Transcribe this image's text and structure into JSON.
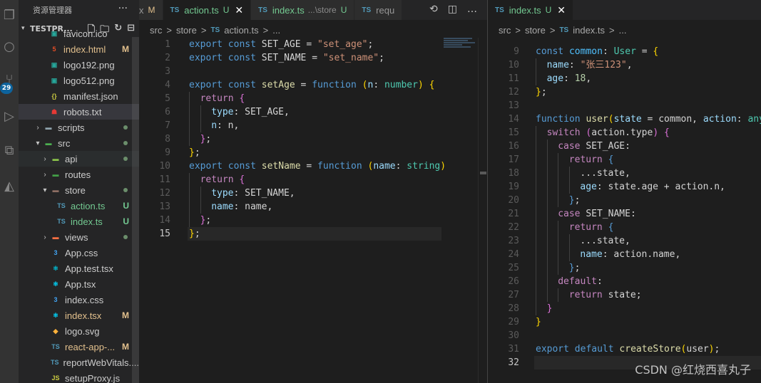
{
  "sidebar": {
    "title": "资源管理器",
    "more": "···",
    "project": "TESTPR...",
    "items": [
      {
        "label": "favicon.ico",
        "icon": "image-icon",
        "status": "",
        "indent": 42
      },
      {
        "label": "index.html",
        "icon": "html5-icon",
        "status": "M",
        "indent": 42
      },
      {
        "label": "logo192.png",
        "icon": "image-icon",
        "status": "",
        "indent": 42
      },
      {
        "label": "logo512.png",
        "icon": "image-icon",
        "status": "",
        "indent": 42
      },
      {
        "label": "manifest.json",
        "icon": "json-braces-icon",
        "status": "",
        "indent": 42
      },
      {
        "label": "robots.txt",
        "icon": "robot-icon",
        "status": "",
        "indent": 42
      },
      {
        "label": "scripts",
        "icon": "folder-icon",
        "status": "dot",
        "indent": 20,
        "folder": "closed"
      },
      {
        "label": "src",
        "icon": "folder-src-icon",
        "status": "dot",
        "indent": 20,
        "folder": "open"
      },
      {
        "label": "api",
        "icon": "folder-api-icon",
        "status": "dot",
        "indent": 30,
        "folder": "closed"
      },
      {
        "label": "routes",
        "icon": "folder-routes-icon",
        "status": "",
        "indent": 30,
        "folder": "closed"
      },
      {
        "label": "store",
        "icon": "folder-store-icon",
        "status": "dot",
        "indent": 30,
        "folder": "open"
      },
      {
        "label": "action.ts",
        "icon": "typescript-icon",
        "status": "U",
        "indent": 52
      },
      {
        "label": "index.ts",
        "icon": "typescript-icon",
        "status": "U",
        "indent": 52
      },
      {
        "label": "views",
        "icon": "folder-views-icon",
        "status": "dot",
        "indent": 30,
        "folder": "closed"
      },
      {
        "label": "App.css",
        "icon": "css-icon",
        "status": "",
        "indent": 44
      },
      {
        "label": "App.test.tsx",
        "icon": "react-test-icon",
        "status": "",
        "indent": 44
      },
      {
        "label": "App.tsx",
        "icon": "react-icon",
        "status": "",
        "indent": 44
      },
      {
        "label": "index.css",
        "icon": "css-icon",
        "status": "",
        "indent": 44
      },
      {
        "label": "index.tsx",
        "icon": "react-icon",
        "status": "M",
        "indent": 44
      },
      {
        "label": "logo.svg",
        "icon": "svg-icon",
        "status": "",
        "indent": 44
      },
      {
        "label": "react-app-...",
        "icon": "typescript-icon",
        "status": "M",
        "indent": 44
      },
      {
        "label": "reportWebVitals....",
        "icon": "typescript-icon",
        "status": "",
        "indent": 44
      },
      {
        "label": "setupProxy.js",
        "icon": "javascript-icon",
        "status": "",
        "indent": 44
      }
    ]
  },
  "left_editor": {
    "tabs": [
      {
        "ext": "",
        "label": "x",
        "status": "M",
        "active": false,
        "partial": true
      },
      {
        "ext": "TS",
        "label": "action.ts",
        "status": "U",
        "active": true,
        "close": "✕"
      },
      {
        "ext": "TS",
        "label": "index.ts",
        "desc": "...\\store",
        "status": "U",
        "active": false
      },
      {
        "ext": "TS",
        "label": "requ",
        "status": "",
        "active": false
      }
    ],
    "breadcrumb": [
      "src",
      ">",
      "store",
      ">",
      "TS",
      "action.ts",
      ">",
      "..."
    ],
    "current_line": 15,
    "lines": [
      {
        "n": 1,
        "indent": 0,
        "tokens": [
          [
            "k",
            "export"
          ],
          [
            "d",
            " "
          ],
          [
            "k",
            "const"
          ],
          [
            "d",
            " SET_AGE = "
          ],
          [
            "s",
            "\"set_age\""
          ],
          [
            "d",
            ";"
          ]
        ]
      },
      {
        "n": 2,
        "indent": 0,
        "tokens": [
          [
            "k",
            "export"
          ],
          [
            "d",
            " "
          ],
          [
            "k",
            "const"
          ],
          [
            "d",
            " SET_NAME = "
          ],
          [
            "s",
            "\"set_name\""
          ],
          [
            "d",
            ";"
          ]
        ]
      },
      {
        "n": 3,
        "indent": 0,
        "tokens": []
      },
      {
        "n": 4,
        "indent": 0,
        "tokens": [
          [
            "k",
            "export"
          ],
          [
            "d",
            " "
          ],
          [
            "k",
            "const"
          ],
          [
            "d",
            " "
          ],
          [
            "f",
            "setAge"
          ],
          [
            "d",
            " = "
          ],
          [
            "k",
            "function"
          ],
          [
            "d",
            " "
          ],
          [
            "p",
            "("
          ],
          [
            "v",
            "n"
          ],
          [
            "d",
            ": "
          ],
          [
            "t",
            "number"
          ],
          [
            "p",
            ")"
          ],
          [
            "d",
            " "
          ],
          [
            "p",
            "{"
          ]
        ]
      },
      {
        "n": 5,
        "indent": 1,
        "tokens": [
          [
            "kw",
            "return"
          ],
          [
            "d",
            " "
          ],
          [
            "p2",
            "{"
          ]
        ]
      },
      {
        "n": 6,
        "indent": 2,
        "tokens": [
          [
            "v",
            "type"
          ],
          [
            "d",
            ": SET_AGE,"
          ]
        ]
      },
      {
        "n": 7,
        "indent": 2,
        "tokens": [
          [
            "v",
            "n"
          ],
          [
            "d",
            ": n,"
          ]
        ]
      },
      {
        "n": 8,
        "indent": 1,
        "tokens": [
          [
            "p2",
            "}"
          ],
          [
            "d",
            ";"
          ]
        ]
      },
      {
        "n": 9,
        "indent": 0,
        "tokens": [
          [
            "p",
            "}"
          ],
          [
            "d",
            ";"
          ]
        ]
      },
      {
        "n": 10,
        "indent": 0,
        "tokens": [
          [
            "k",
            "export"
          ],
          [
            "d",
            " "
          ],
          [
            "k",
            "const"
          ],
          [
            "d",
            " "
          ],
          [
            "f",
            "setName"
          ],
          [
            "d",
            " = "
          ],
          [
            "k",
            "function"
          ],
          [
            "d",
            " "
          ],
          [
            "p",
            "("
          ],
          [
            "v",
            "name"
          ],
          [
            "d",
            ": "
          ],
          [
            "t",
            "string"
          ],
          [
            "p",
            ")"
          ]
        ]
      },
      {
        "n": 11,
        "indent": 1,
        "tokens": [
          [
            "kw",
            "return"
          ],
          [
            "d",
            " "
          ],
          [
            "p2",
            "{"
          ]
        ]
      },
      {
        "n": 12,
        "indent": 2,
        "tokens": [
          [
            "v",
            "type"
          ],
          [
            "d",
            ": SET_NAME,"
          ]
        ]
      },
      {
        "n": 13,
        "indent": 2,
        "tokens": [
          [
            "v",
            "name"
          ],
          [
            "d",
            ": name,"
          ]
        ]
      },
      {
        "n": 14,
        "indent": 1,
        "tokens": [
          [
            "p2",
            "}"
          ],
          [
            "d",
            ";"
          ]
        ]
      },
      {
        "n": 15,
        "indent": 0,
        "tokens": [
          [
            "p",
            "}"
          ],
          [
            "d",
            ";"
          ]
        ]
      }
    ]
  },
  "right_editor": {
    "tabs": [
      {
        "ext": "TS",
        "label": "index.ts",
        "status": "U",
        "active": true,
        "close": "✕"
      }
    ],
    "breadcrumb": [
      "src",
      ">",
      "store",
      ">",
      "TS",
      "index.ts",
      ">",
      "..."
    ],
    "current_line": 32,
    "lines": [
      {
        "n": 9,
        "indent": 0,
        "tokens": [
          [
            "k",
            "const"
          ],
          [
            "d",
            " "
          ],
          [
            "c",
            "common"
          ],
          [
            "d",
            ": "
          ],
          [
            "t",
            "User"
          ],
          [
            "d",
            " = "
          ],
          [
            "p",
            "{"
          ]
        ]
      },
      {
        "n": 10,
        "indent": 1,
        "tokens": [
          [
            "v",
            "name"
          ],
          [
            "d",
            ": "
          ],
          [
            "s",
            "\"张三123\""
          ],
          [
            "d",
            ","
          ]
        ]
      },
      {
        "n": 11,
        "indent": 1,
        "tokens": [
          [
            "v",
            "age"
          ],
          [
            "d",
            ": "
          ],
          [
            "n",
            "18"
          ],
          [
            "d",
            ","
          ]
        ]
      },
      {
        "n": 12,
        "indent": 0,
        "tokens": [
          [
            "p",
            "}"
          ],
          [
            "d",
            ";"
          ]
        ]
      },
      {
        "n": 13,
        "indent": 0,
        "tokens": []
      },
      {
        "n": 14,
        "indent": 0,
        "tokens": [
          [
            "k",
            "function"
          ],
          [
            "d",
            " "
          ],
          [
            "f",
            "user"
          ],
          [
            "p",
            "("
          ],
          [
            "v",
            "state"
          ],
          [
            "d",
            " = common, "
          ],
          [
            "v",
            "action"
          ],
          [
            "d",
            ": "
          ],
          [
            "t",
            "any"
          ]
        ]
      },
      {
        "n": 15,
        "indent": 1,
        "tokens": [
          [
            "kw",
            "switch"
          ],
          [
            "d",
            " "
          ],
          [
            "p2",
            "("
          ],
          [
            "d",
            "action.type"
          ],
          [
            "p2",
            ")"
          ],
          [
            "d",
            " "
          ],
          [
            "p2",
            "{"
          ]
        ]
      },
      {
        "n": 16,
        "indent": 2,
        "tokens": [
          [
            "kw",
            "case"
          ],
          [
            "d",
            " SET_AGE:"
          ]
        ]
      },
      {
        "n": 17,
        "indent": 3,
        "tokens": [
          [
            "kw",
            "return"
          ],
          [
            "d",
            " "
          ],
          [
            "k",
            "{"
          ]
        ]
      },
      {
        "n": 18,
        "indent": 4,
        "tokens": [
          [
            "d",
            "...state,"
          ]
        ]
      },
      {
        "n": 19,
        "indent": 4,
        "tokens": [
          [
            "v",
            "age"
          ],
          [
            "d",
            ": state.age + action.n,"
          ]
        ]
      },
      {
        "n": 20,
        "indent": 3,
        "tokens": [
          [
            "k",
            "}"
          ],
          [
            "d",
            ";"
          ]
        ]
      },
      {
        "n": 21,
        "indent": 2,
        "tokens": [
          [
            "kw",
            "case"
          ],
          [
            "d",
            " SET_NAME:"
          ]
        ]
      },
      {
        "n": 22,
        "indent": 3,
        "tokens": [
          [
            "kw",
            "return"
          ],
          [
            "d",
            " "
          ],
          [
            "k",
            "{"
          ]
        ]
      },
      {
        "n": 23,
        "indent": 4,
        "tokens": [
          [
            "d",
            "...state,"
          ]
        ]
      },
      {
        "n": 24,
        "indent": 4,
        "tokens": [
          [
            "v",
            "name"
          ],
          [
            "d",
            ": action.name,"
          ]
        ]
      },
      {
        "n": 25,
        "indent": 3,
        "tokens": [
          [
            "k",
            "}"
          ],
          [
            "d",
            ";"
          ]
        ]
      },
      {
        "n": 26,
        "indent": 2,
        "tokens": [
          [
            "kw",
            "default"
          ],
          [
            "d",
            ":"
          ]
        ]
      },
      {
        "n": 27,
        "indent": 3,
        "tokens": [
          [
            "kw",
            "return"
          ],
          [
            "d",
            " state;"
          ]
        ]
      },
      {
        "n": 28,
        "indent": 1,
        "tokens": [
          [
            "p2",
            "}"
          ]
        ]
      },
      {
        "n": 29,
        "indent": 0,
        "tokens": [
          [
            "p",
            "}"
          ]
        ]
      },
      {
        "n": 30,
        "indent": 0,
        "tokens": []
      },
      {
        "n": 31,
        "indent": 0,
        "tokens": [
          [
            "k",
            "export"
          ],
          [
            "d",
            " "
          ],
          [
            "k",
            "default"
          ],
          [
            "d",
            " "
          ],
          [
            "f",
            "createStore"
          ],
          [
            "p",
            "("
          ],
          [
            "d",
            "user"
          ],
          [
            "p",
            ")"
          ],
          [
            "d",
            ";"
          ]
        ]
      },
      {
        "n": 32,
        "indent": 0,
        "tokens": []
      }
    ]
  },
  "watermark": "CSDN @红烧西喜丸子",
  "activity_badge": "29",
  "colors": {
    "accent": "#0e639c",
    "untracked": "#73c991",
    "modified": "#e2c08d",
    "ts_icon": "#519aba"
  }
}
